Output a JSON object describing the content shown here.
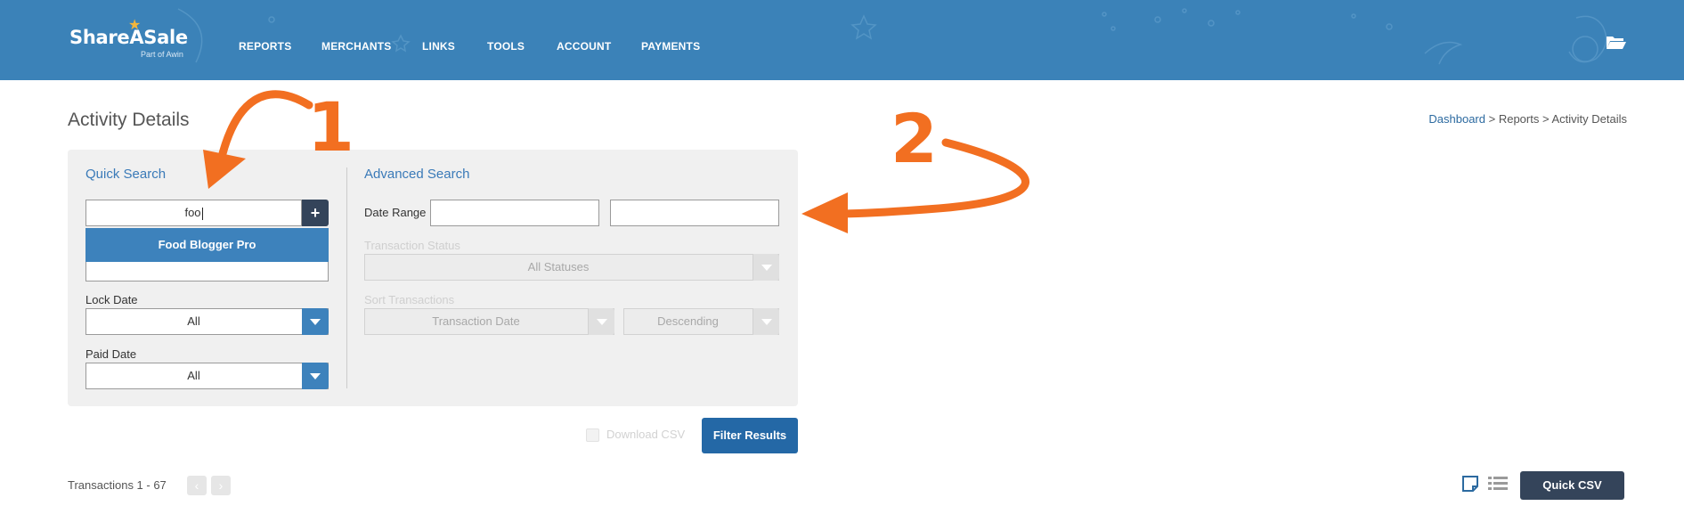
{
  "header": {
    "brand": "ShareASale",
    "brand_sub": "Part of Awin",
    "nav": [
      "REPORTS",
      "MERCHANTS",
      "LINKS",
      "TOOLS",
      "ACCOUNT",
      "PAYMENTS"
    ]
  },
  "page": {
    "title": "Activity Details",
    "breadcrumb": {
      "home": "Dashboard",
      "sep1": " > ",
      "mid": "Reports",
      "sep2": " > ",
      "current": "Activity Details"
    }
  },
  "quick_search": {
    "title": "Quick Search",
    "input_value": "foo",
    "add_label": "+",
    "suggestion": "Food Blogger Pro",
    "lock_date_label": "Lock Date",
    "lock_date_value": "All",
    "paid_date_label": "Paid Date",
    "paid_date_value": "All"
  },
  "advanced_search": {
    "title": "Advanced Search",
    "date_range_label": "Date Range",
    "transaction_status_label": "Transaction Status",
    "transaction_status_value": "All Statuses",
    "sort_label": "Sort Transactions",
    "sort_field_value": "Transaction Date",
    "sort_order_value": "Descending"
  },
  "actions": {
    "download_csv_label": "Download CSV",
    "filter_button": "Filter Results"
  },
  "results": {
    "count_text": "Transactions 1 - 67",
    "prev_icon": "chevron-left-icon",
    "next_icon": "chevron-right-icon",
    "prev_glyph": "‹",
    "next_glyph": "›",
    "quick_csv": "Quick CSV"
  },
  "annotations": {
    "step1": "1",
    "step2": "2"
  },
  "colors": {
    "header_blue": "#3b82b8",
    "accent_blue": "#3d82bc",
    "dark_button": "#34445a",
    "filter_button": "#2468a6",
    "annotation_orange": "#f26f21",
    "logo_star": "#f3b63c"
  }
}
